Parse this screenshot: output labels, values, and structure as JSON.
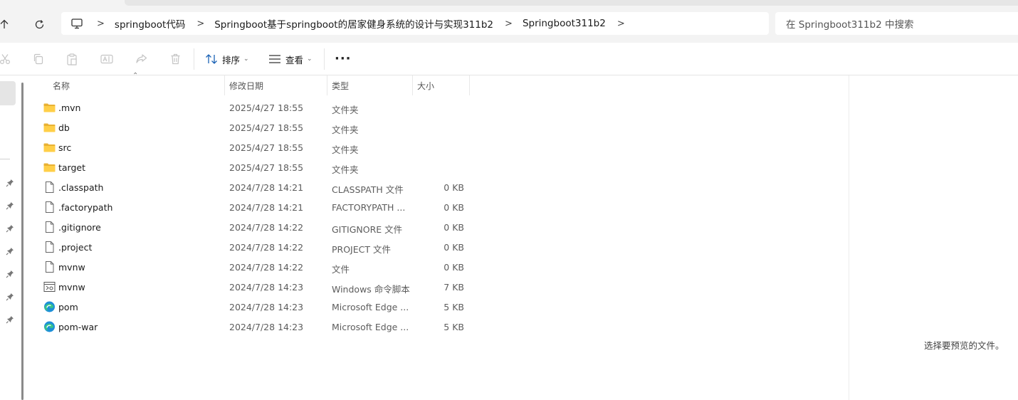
{
  "address_bar": {
    "breadcrumb": [
      "springboot代码",
      "Springboot基于springboot的居家健身系统的设计与实现311b2",
      "Springboot311b2"
    ],
    "search_placeholder": "在 Springboot311b2 中搜索"
  },
  "toolbar": {
    "sort_label": "排序",
    "view_label": "查看"
  },
  "columns": {
    "name": "名称",
    "date": "修改日期",
    "type": "类型",
    "size": "大小"
  },
  "files": [
    {
      "name": ".mvn",
      "date": "2025/4/27 18:55",
      "type": "文件夹",
      "size": "",
      "icon": "folder-icon"
    },
    {
      "name": "db",
      "date": "2025/4/27 18:55",
      "type": "文件夹",
      "size": "",
      "icon": "folder-icon"
    },
    {
      "name": "src",
      "date": "2025/4/27 18:55",
      "type": "文件夹",
      "size": "",
      "icon": "folder-icon"
    },
    {
      "name": "target",
      "date": "2025/4/27 18:55",
      "type": "文件夹",
      "size": "",
      "icon": "folder-icon"
    },
    {
      "name": ".classpath",
      "date": "2024/7/28 14:21",
      "type": "CLASSPATH 文件",
      "size": "0 KB",
      "icon": "file-icon"
    },
    {
      "name": ".factorypath",
      "date": "2024/7/28 14:21",
      "type": "FACTORYPATH ...",
      "size": "0 KB",
      "icon": "file-icon"
    },
    {
      "name": ".gitignore",
      "date": "2024/7/28 14:22",
      "type": "GITIGNORE 文件",
      "size": "0 KB",
      "icon": "file-icon"
    },
    {
      "name": ".project",
      "date": "2024/7/28 14:22",
      "type": "PROJECT 文件",
      "size": "0 KB",
      "icon": "file-icon"
    },
    {
      "name": "mvnw",
      "date": "2024/7/28 14:22",
      "type": "文件",
      "size": "0 KB",
      "icon": "file-icon"
    },
    {
      "name": "mvnw",
      "date": "2024/7/28 14:23",
      "type": "Windows 命令脚本",
      "size": "7 KB",
      "icon": "script-icon"
    },
    {
      "name": "pom",
      "date": "2024/7/28 14:23",
      "type": "Microsoft Edge ...",
      "size": "5 KB",
      "icon": "edge-icon"
    },
    {
      "name": "pom-war",
      "date": "2024/7/28 14:23",
      "type": "Microsoft Edge ...",
      "size": "5 KB",
      "icon": "edge-icon"
    }
  ],
  "preview": {
    "message": "选择要预览的文件。"
  }
}
